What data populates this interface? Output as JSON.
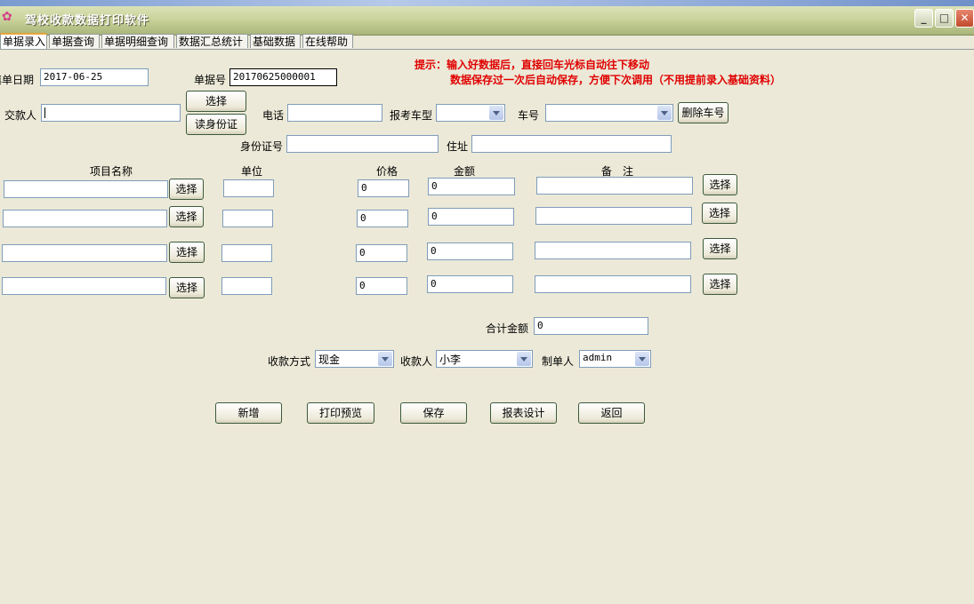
{
  "window": {
    "title": "驾校收款数据打印软件"
  },
  "tabs": [
    "单据录入",
    "单据查询",
    "单据明细查询",
    "数据汇总统计",
    "基础数据",
    "在线帮助"
  ],
  "hints": {
    "line1": "提示：输入好数据后，直接回车光标自动往下移动",
    "line2": "数据保存过一次后自动保存，方便下次调用（不用提前录入基础资料）"
  },
  "form": {
    "date_label": "填单日期",
    "date_value": "2017-06-25",
    "receipt_no_label": "单据号",
    "receipt_no_value": "20170625000001",
    "payer_label": "交款人",
    "payer_value": "",
    "select_label": "选择",
    "read_id_label": "读身份证",
    "phone_label": "电话",
    "phone_value": "",
    "car_type_label": "报考车型",
    "car_type_value": "",
    "car_no_label": "车号",
    "car_no_value": "",
    "delete_car_label": "删除车号",
    "id_no_label": "身份证号",
    "id_no_value": "",
    "address_label": "住址",
    "address_value": ""
  },
  "items": {
    "headers": {
      "name": "项目名称",
      "unit": "单位",
      "price": "价格",
      "amount": "金额",
      "remark": "备　注"
    },
    "select_label": "选择",
    "rows": [
      {
        "name": "",
        "unit": "",
        "price": "0",
        "amount": "0",
        "remark": ""
      },
      {
        "name": "",
        "unit": "",
        "price": "0",
        "amount": "0",
        "remark": ""
      },
      {
        "name": "",
        "unit": "",
        "price": "0",
        "amount": "0",
        "remark": ""
      },
      {
        "name": "",
        "unit": "",
        "price": "0",
        "amount": "0",
        "remark": ""
      }
    ]
  },
  "total": {
    "label": "合计金额",
    "value": "0"
  },
  "payment": {
    "method_label": "收款方式",
    "method_value": "现金",
    "collector_label": "收款人",
    "collector_value": "小李",
    "maker_label": "制单人",
    "maker_value": "admin"
  },
  "actions": {
    "new": "新增",
    "print_preview": "打印预览",
    "save": "保存",
    "report_design": "报表设计",
    "back": "返回"
  }
}
